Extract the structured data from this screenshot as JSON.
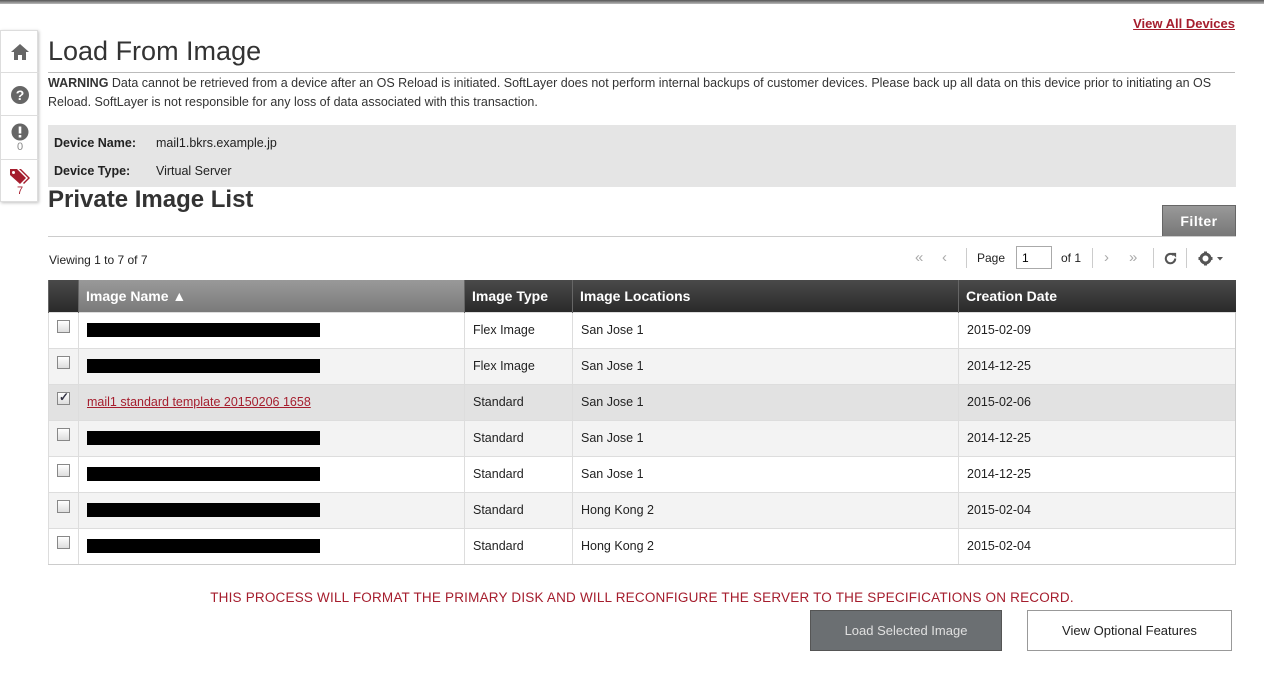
{
  "header": {
    "view_all_link": "View All Devices",
    "title": "Load From Image"
  },
  "rail": {
    "alerts_count": "0",
    "tickets_count": "7"
  },
  "warning": {
    "label": "WARNING",
    "text": " Data cannot be retrieved from a device after an OS Reload is initiated. SoftLayer does not perform internal backups of customer devices. Please back up all data on this device prior to initiating an OS Reload. SoftLayer is not responsible for any loss of data associated with this transaction."
  },
  "device": {
    "name_label": "Device Name:",
    "name_value": "mail1.bkrs.example.jp",
    "type_label": "Device Type:",
    "type_value": "Virtual Server"
  },
  "image_list": {
    "title": "Private Image List",
    "filter_label": "Filter",
    "viewing": "Viewing 1 to 7 of 7",
    "page_label": "Page",
    "page_value": "1",
    "of_label": "of 1",
    "columns": [
      "Image Name ▲",
      "Image Type",
      "Image Locations",
      "Creation Date"
    ],
    "rows": [
      {
        "name": "",
        "redacted": true,
        "checked": false,
        "type": "Flex Image",
        "location": "San Jose 1",
        "date": "2015-02-09"
      },
      {
        "name": "",
        "redacted": true,
        "checked": false,
        "type": "Flex Image",
        "location": "San Jose 1",
        "date": "2014-12-25"
      },
      {
        "name": "mail1 standard template 20150206 1658",
        "redacted": false,
        "checked": true,
        "type": "Standard",
        "location": "San Jose 1",
        "date": "2015-02-06"
      },
      {
        "name": "",
        "redacted": true,
        "checked": false,
        "type": "Standard",
        "location": "San Jose 1",
        "date": "2014-12-25"
      },
      {
        "name": "",
        "redacted": true,
        "checked": false,
        "type": "Standard",
        "location": "San Jose 1",
        "date": "2014-12-25"
      },
      {
        "name": "",
        "redacted": true,
        "checked": false,
        "type": "Standard",
        "location": "Hong Kong 2",
        "date": "2015-02-04"
      },
      {
        "name": "",
        "redacted": true,
        "checked": false,
        "type": "Standard",
        "location": "Hong Kong 2",
        "date": "2015-02-04"
      }
    ]
  },
  "footer": {
    "notice": "THIS PROCESS WILL FORMAT THE PRIMARY DISK AND WILL RECONFIGURE THE SERVER TO THE SPECIFICATIONS ON RECORD.",
    "load_button": "Load Selected Image",
    "optional_button": "View Optional Features"
  },
  "colors": {
    "accent_red": "#a51d2d",
    "header_dark": "#2a2a2a",
    "device_box": "#e5e5e5"
  }
}
